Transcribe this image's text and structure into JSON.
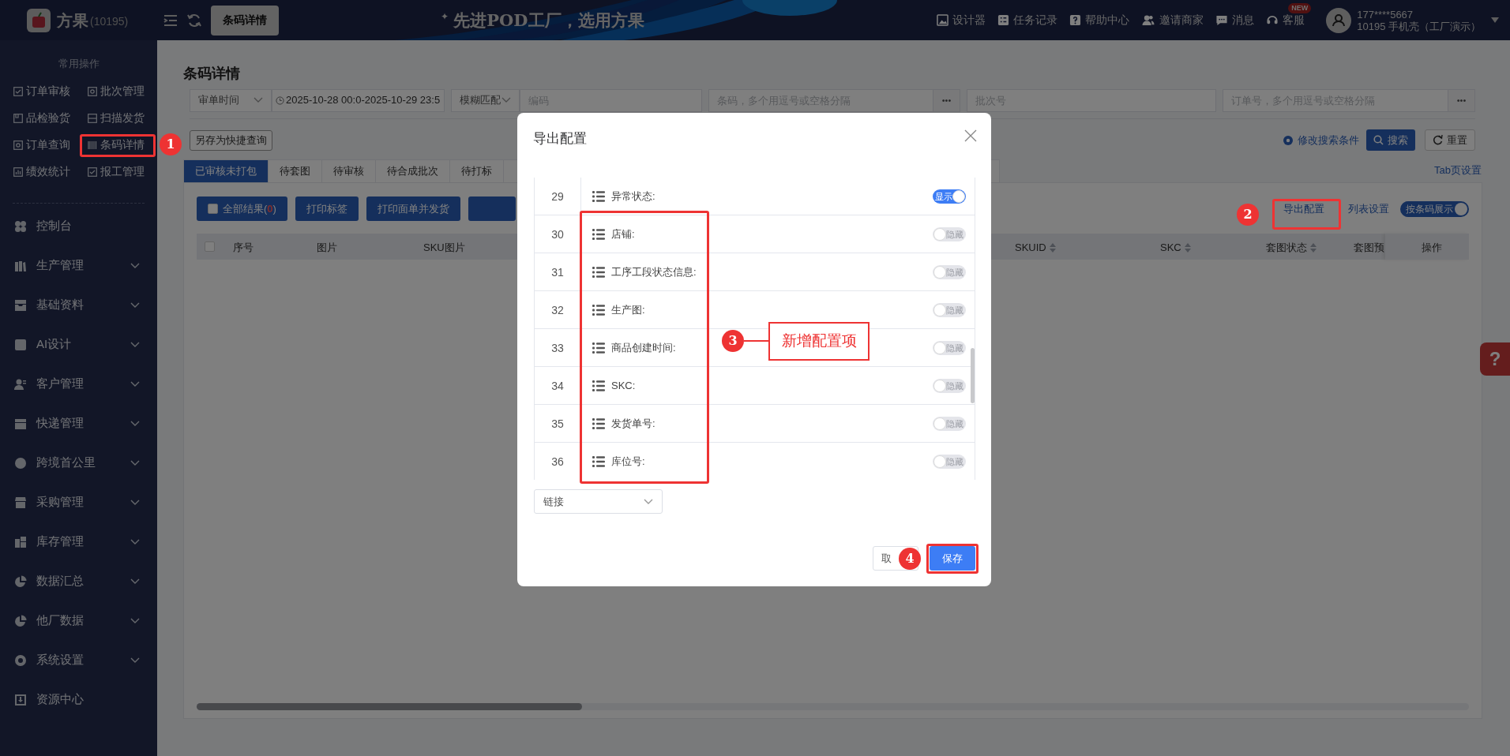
{
  "header": {
    "logo_name": "方果",
    "logo_code": "(10195)",
    "page_tag": "条码详情",
    "slogan_mark": "✦",
    "slogan": "先进POD工厂，选用方果",
    "links": [
      {
        "label": "设计器"
      },
      {
        "label": "任务记录"
      },
      {
        "label": "帮助中心"
      },
      {
        "label": "邀请商家"
      },
      {
        "label": "消息"
      },
      {
        "label": "客服",
        "badge": "NEW"
      }
    ],
    "user": {
      "phone": "177****5667",
      "org": "10195 手机壳（工厂演示）"
    }
  },
  "sidebar": {
    "section_title": "常用操作",
    "quick": [
      "订单审核",
      "批次管理",
      "品检验货",
      "扫描发货",
      "订单查询",
      "条码详情",
      "绩效统计",
      "报工管理"
    ],
    "nav": [
      {
        "label": "控制台",
        "kind": "link"
      },
      {
        "label": "生产管理",
        "kind": "group"
      },
      {
        "label": "基础资料",
        "kind": "group"
      },
      {
        "label": "AI设计",
        "kind": "group"
      },
      {
        "label": "客户管理",
        "kind": "group"
      },
      {
        "label": "快递管理",
        "kind": "group"
      },
      {
        "label": "跨境首公里",
        "kind": "group"
      },
      {
        "label": "采购管理",
        "kind": "group"
      },
      {
        "label": "库存管理",
        "kind": "group"
      },
      {
        "label": "数据汇总",
        "kind": "group"
      },
      {
        "label": "他厂数据",
        "kind": "group"
      },
      {
        "label": "系统设置",
        "kind": "group"
      },
      {
        "label": "资源中心",
        "kind": "link"
      }
    ]
  },
  "page": {
    "title": "条码详情",
    "filters": [
      {
        "kind": "select",
        "value": "审单时间"
      },
      {
        "kind": "date",
        "value": "2025-10-28 00:0-2025-10-29 23:5"
      },
      {
        "kind": "select",
        "value": "模糊匹配"
      },
      {
        "kind": "input",
        "placeholder": "编码"
      },
      {
        "kind": "more",
        "placeholder": "条码，多个用逗号或空格分隔",
        "more": "•••"
      },
      {
        "kind": "input",
        "placeholder": "批次号"
      },
      {
        "kind": "more",
        "placeholder": "订单号，多个用逗号或空格分隔",
        "more": "•••"
      }
    ],
    "save_query": "另存为快捷查询",
    "edit_conditions": "修改搜索条件",
    "search": "搜索",
    "reset": "重置",
    "tabs": [
      {
        "label": "已审核未打包",
        "selected": true
      },
      {
        "label": "待套图",
        "selected": false
      },
      {
        "label": "待审核",
        "selected": false
      },
      {
        "label": "待合成批次",
        "selected": false
      },
      {
        "label": "待打标",
        "selected": false
      }
    ],
    "tab_settings": "Tab页设置",
    "actions": [
      {
        "label": "全部结果(",
        "count": "0",
        "suffix": ")",
        "kind": "check",
        "checked": false
      },
      {
        "label": "打印标签",
        "kind": "plain"
      },
      {
        "label": "打印面单并发货",
        "kind": "plain"
      },
      {
        "kind": "hidden"
      }
    ],
    "export_config": "导出配置",
    "list_settings": "列表设置",
    "barcode_view": {
      "label": "按条码展示",
      "on": true
    },
    "table": {
      "select_all": false,
      "columns": [
        {
          "label": "序号",
          "sortable": false
        },
        {
          "label": "图片",
          "sortable": false
        },
        {
          "label": "SKU图片",
          "sortable": false
        },
        {
          "label": "SKUID",
          "sortable": true
        },
        {
          "label": "SKC",
          "sortable": true
        },
        {
          "label": "套图状态",
          "sortable": true
        },
        {
          "label": "套图预",
          "sortable": false
        },
        {
          "label": "操作",
          "sortable": false
        }
      ]
    }
  },
  "modal": {
    "title": "导出配置",
    "rows": [
      {
        "index": "29",
        "label": "异常状态:",
        "shown": true,
        "switch_text": "显示"
      },
      {
        "index": "30",
        "label": "店铺:",
        "shown": false,
        "switch_text": "隐藏"
      },
      {
        "index": "31",
        "label": "工序工段状态信息:",
        "shown": false,
        "switch_text": "隐藏"
      },
      {
        "index": "32",
        "label": "生产图:",
        "shown": false,
        "switch_text": "隐藏"
      },
      {
        "index": "33",
        "label": "商品创建时间:",
        "shown": false,
        "switch_text": "隐藏"
      },
      {
        "index": "34",
        "label": "SKC:",
        "shown": false,
        "switch_text": "隐藏"
      },
      {
        "index": "35",
        "label": "发货单号:",
        "shown": false,
        "switch_text": "隐藏"
      },
      {
        "index": "36",
        "label": "库位号:",
        "shown": false,
        "switch_text": "隐藏"
      }
    ],
    "format": "链接",
    "cancel": "取",
    "save": "保存"
  },
  "annotations": {
    "steps": [
      "1",
      "2",
      "3",
      "4"
    ],
    "callout": "新增配置项"
  },
  "help_tab": "?"
}
